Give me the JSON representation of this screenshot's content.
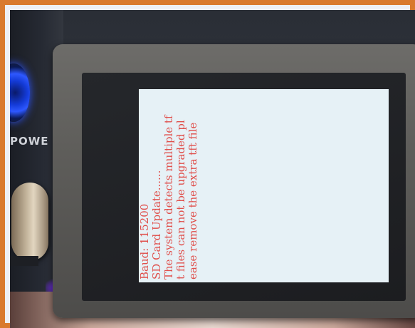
{
  "device": {
    "power_label": "POWE",
    "screen_lines": [
      "Baud: 115200",
      "SD Card Update......",
      "The system detects multiple tf",
      "t files can not be upgraded pl",
      "ease remove the extra tft file"
    ]
  },
  "colors": {
    "frame": "#d97a2e",
    "screen_background": "#e6f1f6",
    "screen_text": "#e0504c",
    "power_ring": "#2e58ff"
  }
}
